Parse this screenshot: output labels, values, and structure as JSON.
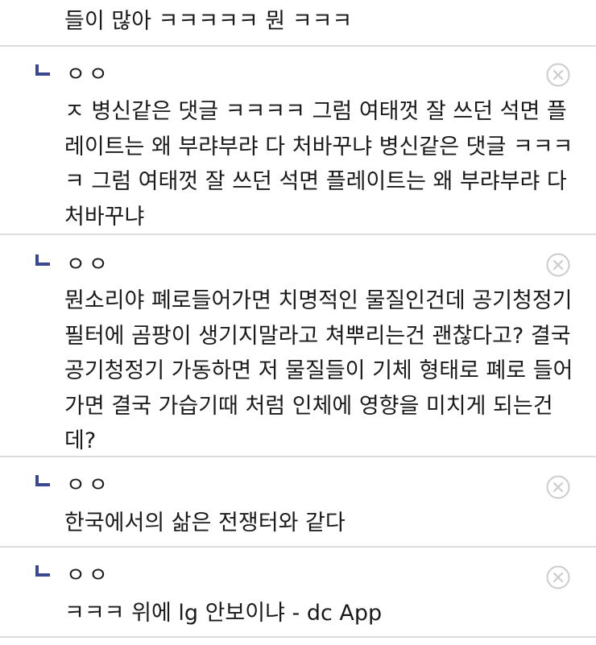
{
  "top_fragment": {
    "text": "들이 많아 ㅋㅋㅋㅋㅋ 뭔 ㅋㅋㅋ"
  },
  "replies": [
    {
      "nick": "ㅇㅇ",
      "text": "ㅈ 병신같은 댓글 ㅋㅋㅋㅋ 그럼 여태껏 잘 쓰던 석면 플레이트는 왜 부랴부랴 다 처바꾸냐 병신같은 댓글 ㅋㅋㅋ ㅋ 그럼 여태껏 잘 쓰던 석면 플레이트는 왜 부랴부랴 다 처바꾸냐"
    },
    {
      "nick": "ㅇㅇ",
      "text": "뭔소리야 폐로들어가면 치명적인 물질인건데 공기청정기 필터에 곰팡이 생기지말라고 쳐뿌리는건 괜찮다고? 결국 공기청정기 가동하면 저 물질들이 기체 형태로 폐로 들어가면 결국 가습기때 처럼 인체에 영향을 미치게 되는건데?"
    },
    {
      "nick": "ㅇㅇ",
      "text": "한국에서의 삶은 전쟁터와 같다"
    },
    {
      "nick": "ㅇㅇ",
      "text": "ㅋㅋㅋ 위에 lg 안보이냐 - dc App"
    }
  ],
  "colors": {
    "reply_arrow": "#3b4890",
    "divider": "#dddddd",
    "delete_icon": "#cccccc"
  },
  "icons": {
    "reply": "reply-arrow-icon",
    "delete": "circle-x-icon"
  }
}
